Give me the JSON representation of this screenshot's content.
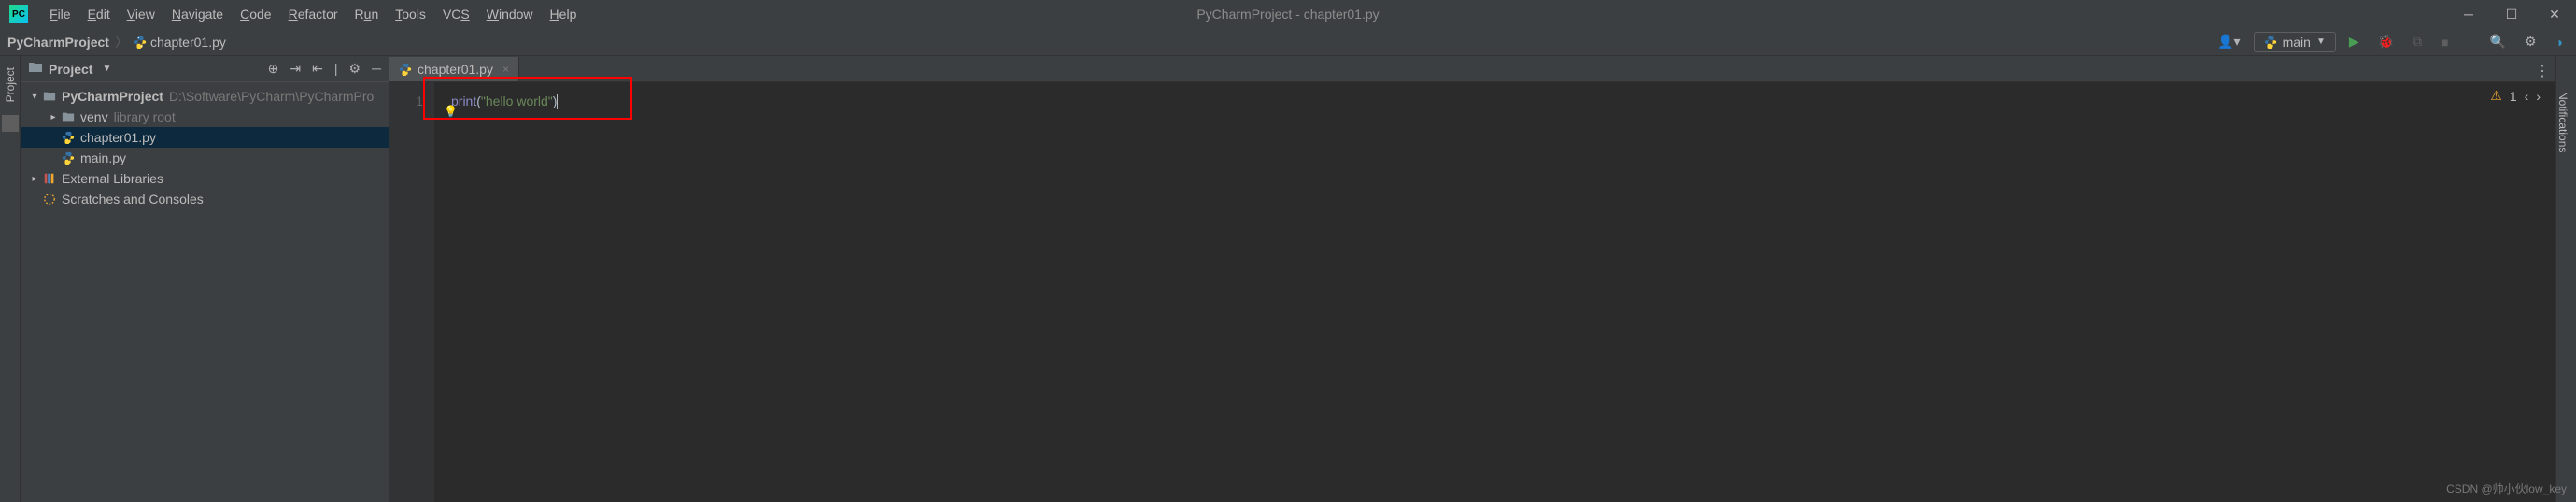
{
  "window": {
    "title": "PyCharmProject - chapter01.py"
  },
  "menu": [
    "File",
    "Edit",
    "View",
    "Navigate",
    "Code",
    "Refactor",
    "Run",
    "Tools",
    "VCS",
    "Window",
    "Help"
  ],
  "breadcrumbs": {
    "project": "PyCharmProject",
    "file": "chapter01.py"
  },
  "runConfig": {
    "name": "main"
  },
  "projectPanel": {
    "title": "Project"
  },
  "tree": {
    "root": {
      "name": "PyCharmProject",
      "path": "D:\\Software\\PyCharm\\PyCharmPro"
    },
    "venv": {
      "name": "venv",
      "tag": "library root"
    },
    "files": [
      "chapter01.py",
      "main.py"
    ],
    "external": "External Libraries",
    "scratches": "Scratches and Consoles"
  },
  "editor": {
    "tab": "chapter01.py",
    "lineNo": "1",
    "code": {
      "fn": "print",
      "open": "(",
      "str": "\"hello world\"",
      "close": ")"
    },
    "warnings": "1"
  },
  "rightRail": {
    "label": "Notifications"
  },
  "leftRail": {
    "label": "Project"
  },
  "watermark": "CSDN @帅小伙low_key"
}
